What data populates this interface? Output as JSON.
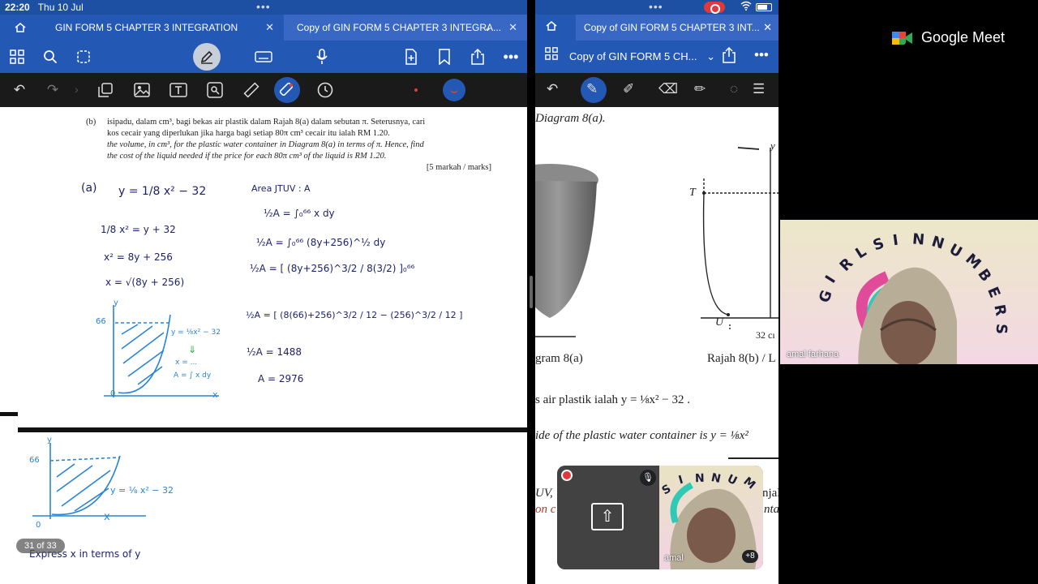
{
  "status": {
    "time": "22:20",
    "date": "Thu 10 Jul"
  },
  "left_tabs": [
    {
      "label": "GIN FORM 5 CHAPTER 3 INTEGRATION"
    },
    {
      "label": "Copy of GIN FORM 5 CHAPTER 3 INTEGRA..."
    }
  ],
  "question": {
    "label": "(b)",
    "line1": "isipadu, dalam cm³, bagi bekas air plastik dalam Rajah 8(a) dalam sebutan π. Seterusnya, cari",
    "line2": "kos cecair yang diperlukan jika harga bagi setiap  80π cm³  cecair itu ialah RM 1.20.",
    "line3": "the volume, in cm³, for the plastic water container in Diagram 8(a) in terms of π. Hence, find",
    "line4": "the cost of the liquid needed if the price for each  80π cm³  of the liquid is RM 1.20.",
    "marks": "[5 markah / marks]"
  },
  "handwriting": {
    "part": "(a)",
    "eq1": "y = 1/8 x² − 32",
    "eq2": "1/8 x² = y + 32",
    "eq3": "x² = 8y + 256",
    "eq4": "x = √(8y + 256)",
    "area_title": "Area JTUV : A",
    "int1": "½A = ∫₀⁶⁶ x dy",
    "int2": "½A = ∫₀⁶⁶ (8y+256)^½ dy",
    "int3": "½A = [ (8y+256)^3/2 / 8(3/2) ]₀⁶⁶",
    "int4": "½A = [ (8(66)+256)^3/2 / 12 − (256)^3/2 / 12 ]",
    "int5": "½A = 1488",
    "int6": "A = 2976",
    "g1_y": "y",
    "g1_66": "66",
    "g1_curve": "y = ⅛x² − 32",
    "g1_arrow": "⇓",
    "g1_xeq": "x = ...",
    "g1_aeq": "A = ∫ x dy",
    "g1_o": "0",
    "g1_x": "x",
    "g2_y": "y",
    "g2_66": "66",
    "g2_curve": "y = ⅛ x² − 32",
    "g2_x": "x",
    "g2_o": "0",
    "express": "Express x in terms of y"
  },
  "page_indicator": "31 of 33",
  "right": {
    "tab_label": "Copy of GIN FORM 5 CHAPTER 3 INT...",
    "title": "Copy of GIN FORM 5 CH...",
    "diagram_a": "Diagram 8(a).",
    "label_T": "T",
    "label_U": "U",
    "label_32": "32 cı",
    "label_y": "y",
    "cap_a": "gram 8(a)",
    "cap_b": "Rajah 8(b) / L",
    "eq_ms": "s air plastik ialah  y = ⅛x² − 32 .",
    "eq_en": "ide of the plastic water container is  y = ⅛x²",
    "uv": "UV,",
    "uv_red": "on c",
    "jal": "njal",
    "nta": "nta"
  },
  "meet": {
    "brand": "Google Meet",
    "participant": "amal farhana",
    "pip_name": "amal",
    "overflow": "+8",
    "banner_letters": [
      "G",
      "I",
      "R",
      "L",
      "S",
      "I",
      "N",
      "N",
      "U",
      "M",
      "B",
      "E",
      "R",
      "S"
    ],
    "pip_letters": [
      "S",
      "I",
      "N",
      "N",
      "U",
      "M"
    ]
  },
  "colors": {
    "tab_blue": "#2458b5",
    "toolbar_dark": "#1a1a1a",
    "ink_blue": "#1b1f6b",
    "sketch_blue": "#2a84d6",
    "record_red": "#e0393b"
  }
}
